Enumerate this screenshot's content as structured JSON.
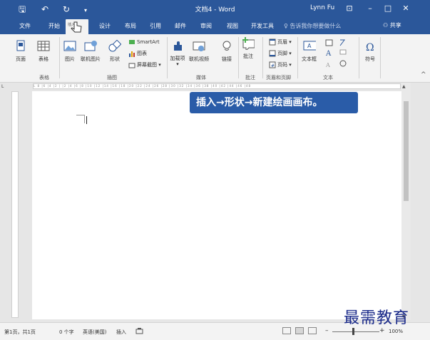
{
  "titlebar": {
    "quick_access": [
      "🖫",
      "↶",
      "↻",
      "▾"
    ],
    "title": "文档4 - Word",
    "user": "Lynn Fu",
    "ribbon_display": "⊡",
    "minimize": "–",
    "maximize": "□",
    "close": "✕"
  },
  "tabs": [
    "文件",
    "开始",
    "插入",
    "设计",
    "布局",
    "引用",
    "邮件",
    "审阅",
    "视图",
    "开发工具"
  ],
  "tellme": "♀ 告诉我你想要做什么",
  "share": "⚇ 共享",
  "ribbon": {
    "page": "页面",
    "table": "表格",
    "picture": "图片",
    "online_picture": "联机图片",
    "shapes": "形状",
    "smartart": "SmartArt",
    "chart": "图表",
    "screenshot": "屏幕截图 ▾",
    "addins": "加载项 ▾",
    "online_video": "联机视频",
    "link": "链接",
    "comment": "批注",
    "header": "页眉 ▾",
    "footer": "页脚 ▾",
    "page_number": "页码 ▾",
    "textbox": "文本框",
    "symbol": "符号",
    "groups": {
      "tables": "表格",
      "illustrations": "插图",
      "media": "媒体",
      "comments": "批注",
      "header_footer": "页眉和页脚",
      "text": "文本"
    },
    "collapse": "^"
  },
  "ruler_marks": "L   8  |6 |4 |2 | |2 |4 |6 |8 |10 |12 |14 |16 |18 |20 |22 |24 |26 |28 |30 |32 |34 |36 |38 |40 |42 |44 |46 |48",
  "callout": "插入→形状→新建绘画画布。",
  "status": {
    "page": "第1页，共1页",
    "words": "0 个字",
    "language": "英语(美国)",
    "mode": "插入",
    "zoom_minus": "–",
    "zoom_plus": "+",
    "zoom": "100%"
  },
  "watermark": "最需教育",
  "colors": {
    "accent": "#2b579a",
    "callout": "#2a5ca8"
  }
}
